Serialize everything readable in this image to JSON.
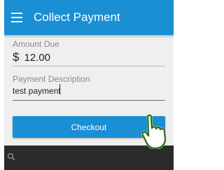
{
  "app_bar": {
    "title": "Collect Payment",
    "menu_icon": "hamburger-menu-icon",
    "color": "#1a8fd3"
  },
  "amount": {
    "label": "Amount Due",
    "currency_symbol": "$",
    "value": "12.00"
  },
  "description": {
    "label": "Payment Description",
    "value": "test payment"
  },
  "checkout": {
    "label": "Checkout",
    "color": "#1a8fd3"
  },
  "bottom_bar": {
    "icon": "search-icon",
    "color": "#2b2b2b"
  },
  "overlay": {
    "icon": "tap-hand-icon",
    "accent": "#7ed957"
  }
}
